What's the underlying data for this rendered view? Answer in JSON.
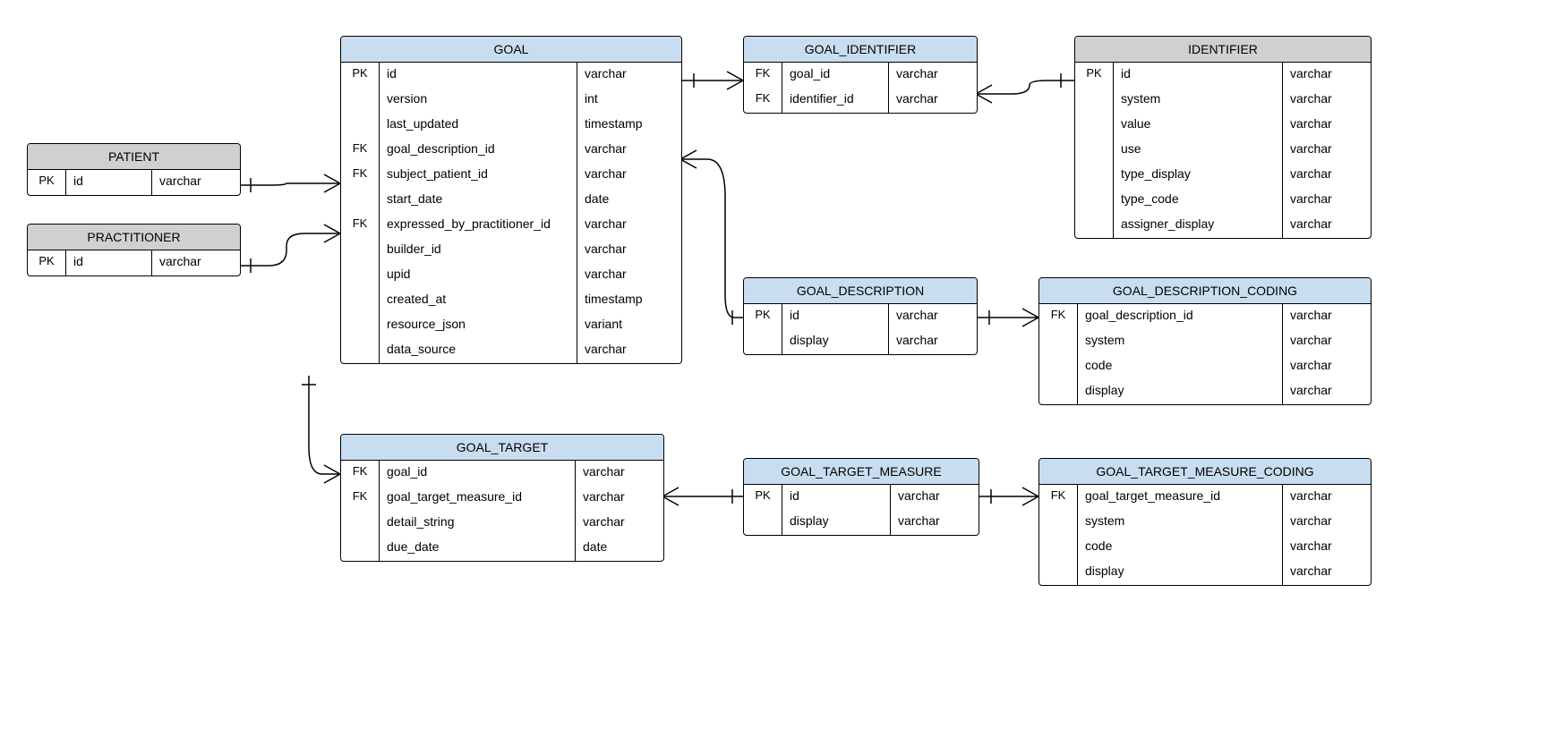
{
  "entities": {
    "patient": {
      "title": "PATIENT",
      "header_style": "gray",
      "columns": [
        {
          "key": "PK",
          "name": "id",
          "type": "varchar"
        }
      ]
    },
    "practitioner": {
      "title": "PRACTITIONER",
      "header_style": "gray",
      "columns": [
        {
          "key": "PK",
          "name": "id",
          "type": "varchar"
        }
      ]
    },
    "goal": {
      "title": "GOAL",
      "header_style": "blue",
      "columns": [
        {
          "key": "PK",
          "name": "id",
          "type": "varchar"
        },
        {
          "key": "",
          "name": "version",
          "type": "int"
        },
        {
          "key": "",
          "name": "last_updated",
          "type": "timestamp"
        },
        {
          "key": "FK",
          "name": "goal_description_id",
          "type": "varchar"
        },
        {
          "key": "FK",
          "name": "subject_patient_id",
          "type": "varchar"
        },
        {
          "key": "",
          "name": "start_date",
          "type": "date"
        },
        {
          "key": "FK",
          "name": "expressed_by_practitioner_id",
          "type": "varchar"
        },
        {
          "key": "",
          "name": "builder_id",
          "type": "varchar"
        },
        {
          "key": "",
          "name": "upid",
          "type": "varchar"
        },
        {
          "key": "",
          "name": "created_at",
          "type": "timestamp"
        },
        {
          "key": "",
          "name": "resource_json",
          "type": "variant"
        },
        {
          "key": "",
          "name": "data_source",
          "type": "varchar"
        }
      ]
    },
    "goal_identifier": {
      "title": "GOAL_IDENTIFIER",
      "header_style": "blue",
      "columns": [
        {
          "key": "FK",
          "name": "goal_id",
          "type": "varchar"
        },
        {
          "key": "FK",
          "name": "identifier_id",
          "type": "varchar"
        }
      ]
    },
    "identifier": {
      "title": "IDENTIFIER",
      "header_style": "gray",
      "columns": [
        {
          "key": "PK",
          "name": "id",
          "type": "varchar"
        },
        {
          "key": "",
          "name": "system",
          "type": "varchar"
        },
        {
          "key": "",
          "name": "value",
          "type": "varchar"
        },
        {
          "key": "",
          "name": "use",
          "type": "varchar"
        },
        {
          "key": "",
          "name": "type_display",
          "type": "varchar"
        },
        {
          "key": "",
          "name": "type_code",
          "type": "varchar"
        },
        {
          "key": "",
          "name": "assigner_display",
          "type": "varchar"
        }
      ]
    },
    "goal_description": {
      "title": "GOAL_DESCRIPTION",
      "header_style": "blue",
      "columns": [
        {
          "key": "PK",
          "name": "id",
          "type": "varchar"
        },
        {
          "key": "",
          "name": "display",
          "type": "varchar"
        }
      ]
    },
    "goal_description_coding": {
      "title": "GOAL_DESCRIPTION_CODING",
      "header_style": "blue",
      "columns": [
        {
          "key": "FK",
          "name": "goal_description_id",
          "type": "varchar"
        },
        {
          "key": "",
          "name": "system",
          "type": "varchar"
        },
        {
          "key": "",
          "name": "code",
          "type": "varchar"
        },
        {
          "key": "",
          "name": "display",
          "type": "varchar"
        }
      ]
    },
    "goal_target": {
      "title": "GOAL_TARGET",
      "header_style": "blue",
      "columns": [
        {
          "key": "FK",
          "name": "goal_id",
          "type": "varchar"
        },
        {
          "key": "FK",
          "name": "goal_target_measure_id",
          "type": "varchar"
        },
        {
          "key": "",
          "name": "detail_string",
          "type": "varchar"
        },
        {
          "key": "",
          "name": "due_date",
          "type": "date"
        }
      ]
    },
    "goal_target_measure": {
      "title": "GOAL_TARGET_MEASURE",
      "header_style": "blue",
      "columns": [
        {
          "key": "PK",
          "name": "id",
          "type": "varchar"
        },
        {
          "key": "",
          "name": "display",
          "type": "varchar"
        }
      ]
    },
    "goal_target_measure_coding": {
      "title": "GOAL_TARGET_MEASURE_CODING",
      "header_style": "blue",
      "columns": [
        {
          "key": "FK",
          "name": "goal_target_measure_id",
          "type": "varchar"
        },
        {
          "key": "",
          "name": "system",
          "type": "varchar"
        },
        {
          "key": "",
          "name": "code",
          "type": "varchar"
        },
        {
          "key": "",
          "name": "display",
          "type": "varchar"
        }
      ]
    }
  },
  "relationships": [
    {
      "from": "patient",
      "to": "goal",
      "type": "one-to-many"
    },
    {
      "from": "practitioner",
      "to": "goal",
      "type": "one-to-many"
    },
    {
      "from": "goal",
      "to": "goal_identifier",
      "type": "one-to-many"
    },
    {
      "from": "identifier",
      "to": "goal_identifier",
      "type": "one-to-many"
    },
    {
      "from": "goal",
      "to": "goal_description",
      "type": "many-to-one"
    },
    {
      "from": "goal_description",
      "to": "goal_description_coding",
      "type": "one-to-many"
    },
    {
      "from": "goal",
      "to": "goal_target",
      "type": "one-to-many"
    },
    {
      "from": "goal_target",
      "to": "goal_target_measure",
      "type": "many-to-one"
    },
    {
      "from": "goal_target_measure",
      "to": "goal_target_measure_coding",
      "type": "one-to-many"
    }
  ]
}
